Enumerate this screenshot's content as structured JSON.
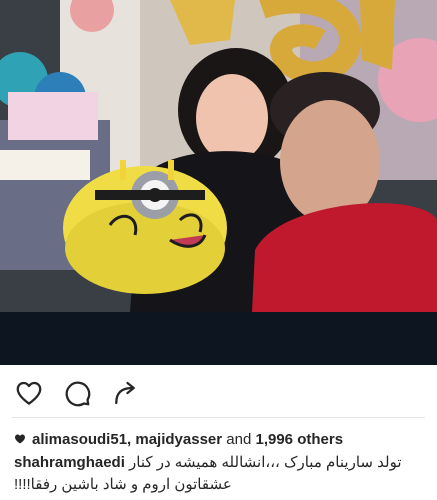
{
  "post": {
    "photo_alt": "Birthday photo"
  },
  "actions": {
    "like_icon": "heart-outline-icon",
    "comment_icon": "comment-bubble-icon",
    "share_icon": "share-arrow-icon"
  },
  "likes": {
    "users": "alimasoudi51, majidyasser",
    "and_word": "and",
    "count": "1,996 others"
  },
  "caption": {
    "username": "shahramghaedi",
    "text_line1": "تولد سارینام مبارک ،،،انشالله همیشه در کنار",
    "text_line2": "عشقاتون اروم و شاد باشین رفقا!!!!"
  },
  "colors": {
    "text": "#262626",
    "divider": "#e6e6e6",
    "strip": "#0d1520"
  }
}
